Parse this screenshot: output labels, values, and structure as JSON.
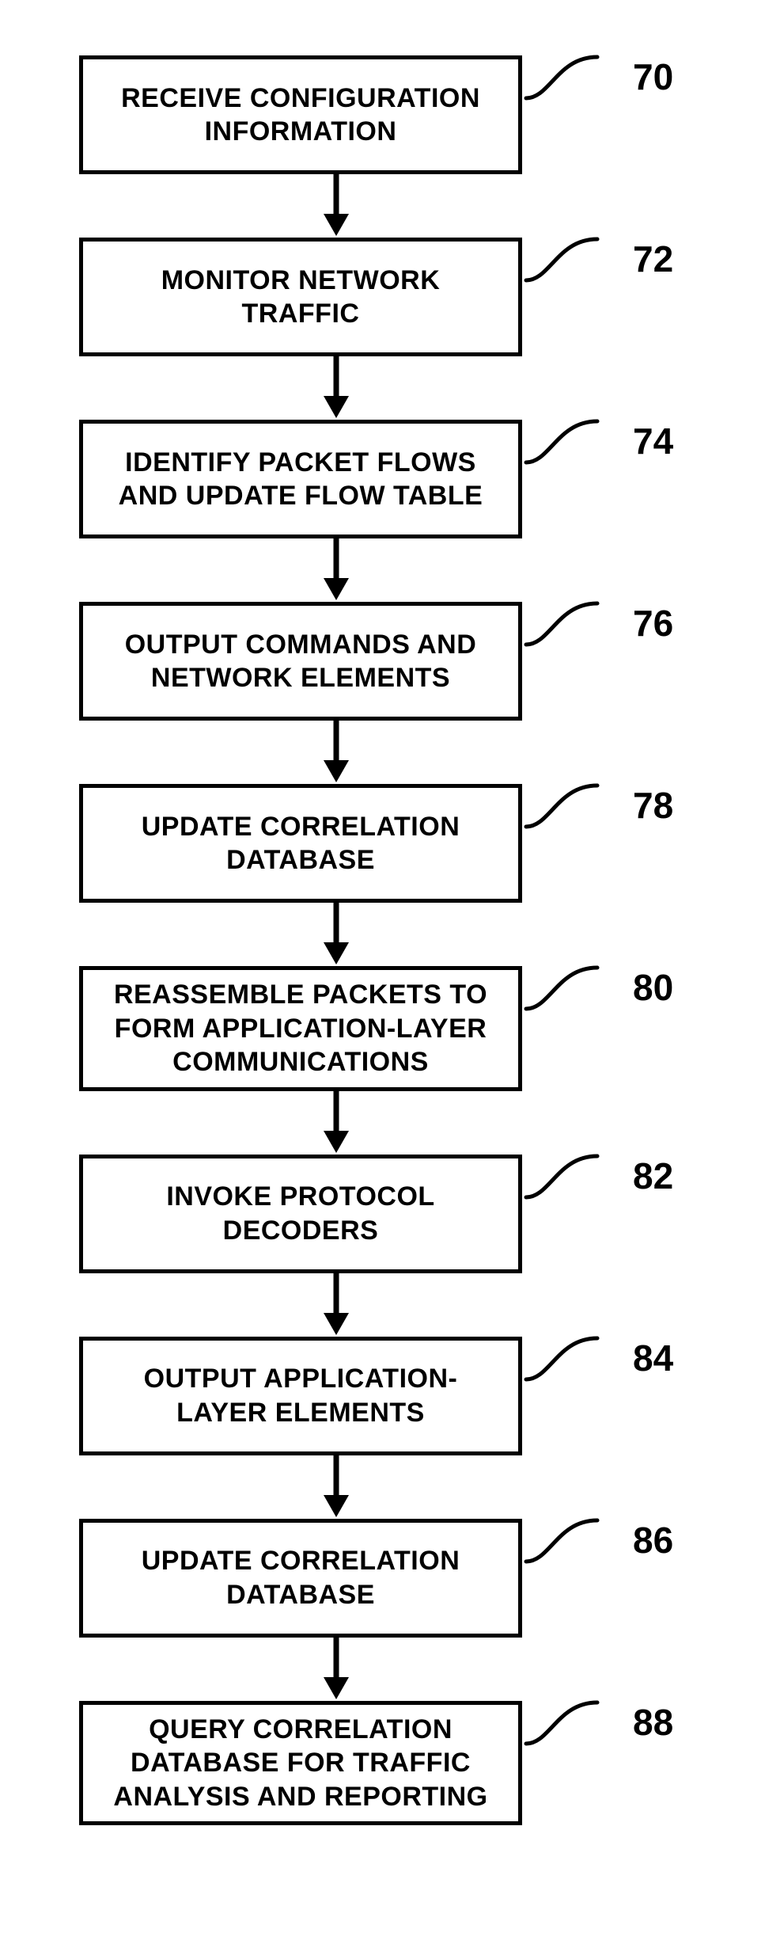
{
  "flowchart": {
    "steps": [
      {
        "label": "RECEIVE CONFIGURATION INFORMATION",
        "ref": "70"
      },
      {
        "label": "MONITOR NETWORK TRAFFIC",
        "ref": "72"
      },
      {
        "label": "IDENTIFY PACKET FLOWS AND UPDATE FLOW TABLE",
        "ref": "74"
      },
      {
        "label": "OUTPUT COMMANDS AND NETWORK ELEMENTS",
        "ref": "76"
      },
      {
        "label": "UPDATE CORRELATION DATABASE",
        "ref": "78"
      },
      {
        "label": "REASSEMBLE PACKETS TO FORM APPLICATION-LAYER COMMUNICATIONS",
        "ref": "80"
      },
      {
        "label": "INVOKE PROTOCOL DECODERS",
        "ref": "82"
      },
      {
        "label": "OUTPUT APPLICATION-LAYER ELEMENTS",
        "ref": "84"
      },
      {
        "label": "UPDATE CORRELATION DATABASE",
        "ref": "86"
      },
      {
        "label": "QUERY CORRELATION DATABASE FOR TRAFFIC ANALYSIS AND REPORTING",
        "ref": "88"
      }
    ]
  }
}
